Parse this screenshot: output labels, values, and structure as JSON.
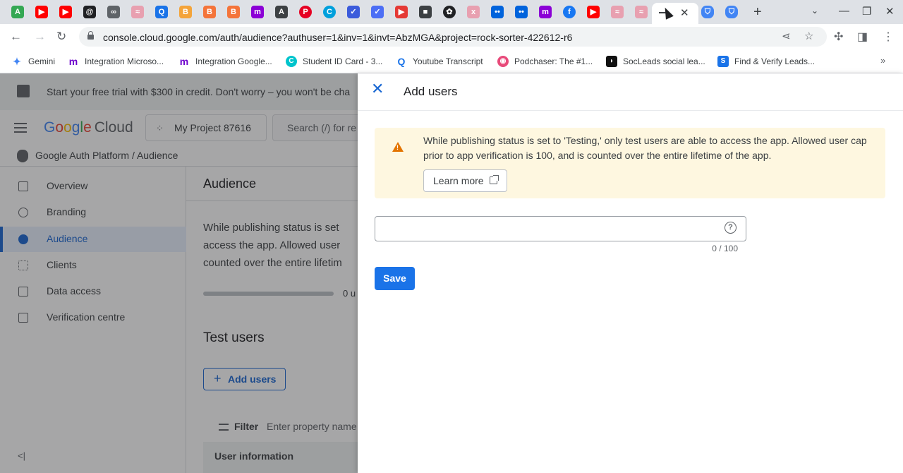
{
  "browser": {
    "url": "console.cloud.google.com/auth/audience?authuser=1&inv=1&invt=AbzMGA&project=rock-sorter-422612-r6",
    "tab_close": "✕",
    "new_tab": "+"
  },
  "bookmarks": [
    {
      "label": "Gemini",
      "icon": "gemini-icon",
      "color": "#4285f4"
    },
    {
      "label": "Integration Microso...",
      "icon": "make-icon",
      "color": "#6d00cc"
    },
    {
      "label": "Integration Google...",
      "icon": "make-icon",
      "color": "#6d00cc"
    },
    {
      "label": "Student ID Card - 3...",
      "icon": "canva-icon",
      "color": "#00c4cc"
    },
    {
      "label": "Youtube Transcript",
      "icon": "search-q-icon",
      "color": "#1a73e8"
    },
    {
      "label": "Podchaser: The #1...",
      "icon": "podchaser-icon",
      "color": "#e84a7a"
    },
    {
      "label": "SocLeads social lea...",
      "icon": "socleads-icon",
      "color": "#111111"
    },
    {
      "label": "Find & Verify Leads...",
      "icon": "verify-icon",
      "color": "#1a73e8"
    }
  ],
  "console": {
    "trial_text": "Start your free trial with $300 in credit. Don't worry – you won't be cha",
    "logo_google": [
      "G",
      "o",
      "o",
      "g",
      "l",
      "e"
    ],
    "logo_cloud": "Cloud",
    "project": "My Project 87616",
    "search_placeholder": "Search (/) for re",
    "breadcrumb": "Google Auth Platform  /  Audience",
    "nav": [
      {
        "label": "Overview",
        "icon": "overview-icon",
        "active": false
      },
      {
        "label": "Branding",
        "icon": "palette-icon",
        "active": false
      },
      {
        "label": "Audience",
        "icon": "person-icon",
        "active": true
      },
      {
        "label": "Clients",
        "icon": "grid-icon",
        "active": false
      },
      {
        "label": "Data access",
        "icon": "data-access-icon",
        "active": false
      },
      {
        "label": "Verification centre",
        "icon": "checkbox-icon",
        "active": false
      }
    ],
    "collapse_icon": "<|",
    "main_title": "Audience",
    "main_para": [
      "While publishing status is set",
      "access the app. Allowed user",
      "counted over the entire lifetim"
    ],
    "progress_text": "0 u",
    "test_users_title": "Test users",
    "add_users_label": "Add users",
    "filter_label": "Filter",
    "filter_placeholder": "Enter property name",
    "table_header": "User information"
  },
  "panel": {
    "title": "Add users",
    "warning": "While publishing status is set to 'Testing,' only test users are able to access the app. Allowed user cap prior to app verification is 100, and is counted over the entire lifetime of the app.",
    "learn_more": "Learn more",
    "input_value": "",
    "input_placeholder": "",
    "help_icon": "?",
    "counter": "0 / 100",
    "save": "Save"
  }
}
